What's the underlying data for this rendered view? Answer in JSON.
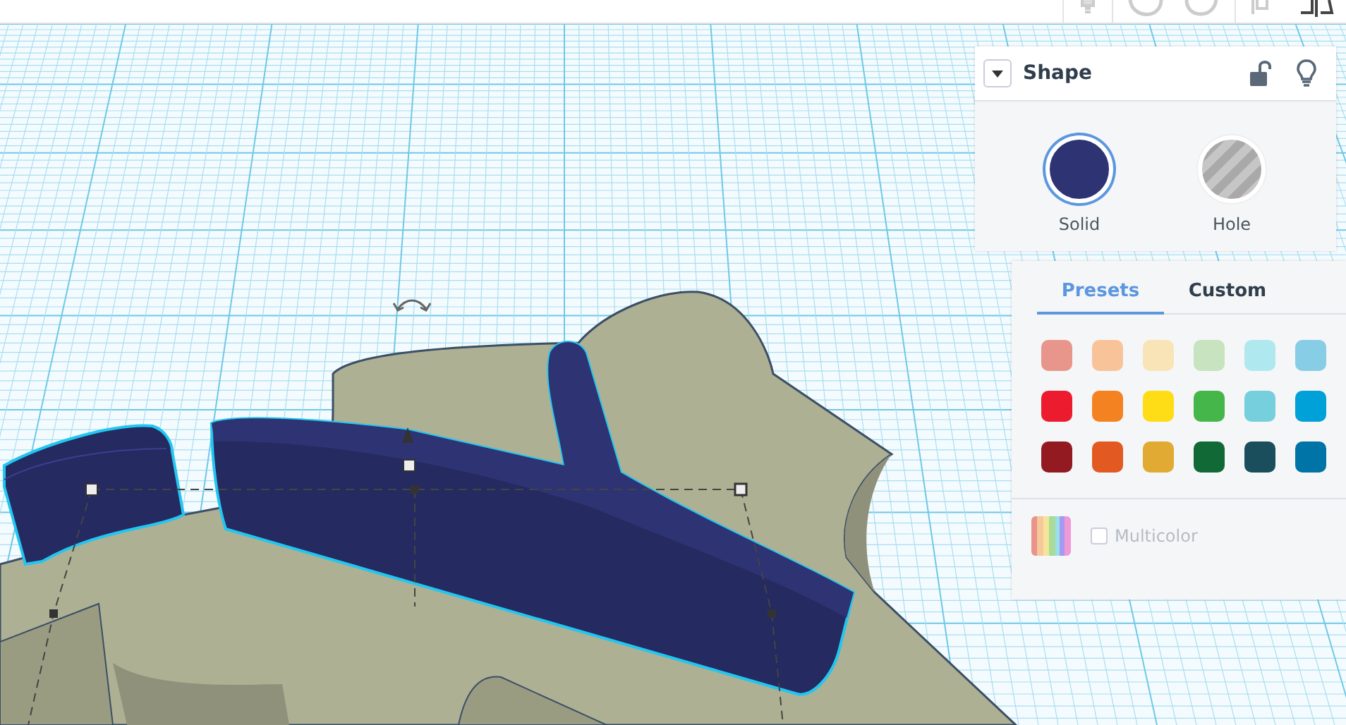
{
  "shape_panel": {
    "title": "Shape",
    "locked": false,
    "options": [
      {
        "kind": "solid",
        "label": "Solid",
        "selected": true
      },
      {
        "kind": "hole",
        "label": "Hole",
        "selected": false
      }
    ]
  },
  "color_panel": {
    "tabs": [
      {
        "label": "Presets",
        "selected": true
      },
      {
        "label": "Custom",
        "selected": false
      }
    ],
    "swatches": [
      {
        "color": "#e8968c"
      },
      {
        "color": "#f9c39a"
      },
      {
        "color": "#f9e4b8"
      },
      {
        "color": "#c7e3bf"
      },
      {
        "color": "#b0e8ef"
      },
      {
        "color": "#88cde6"
      },
      {
        "color": "#ec1c2e"
      },
      {
        "color": "#f58220"
      },
      {
        "color": "#fedd17"
      },
      {
        "color": "#45b649"
      },
      {
        "color": "#76cfdd"
      },
      {
        "color": "#00a0d9"
      },
      {
        "color": "#941a22"
      },
      {
        "color": "#e25a22"
      },
      {
        "color": "#e1ab33"
      },
      {
        "color": "#116a36"
      },
      {
        "color": "#1b4e5c"
      },
      {
        "color": "#0074a6"
      }
    ],
    "multicolor": {
      "label": "Multicolor",
      "checked": false
    }
  }
}
